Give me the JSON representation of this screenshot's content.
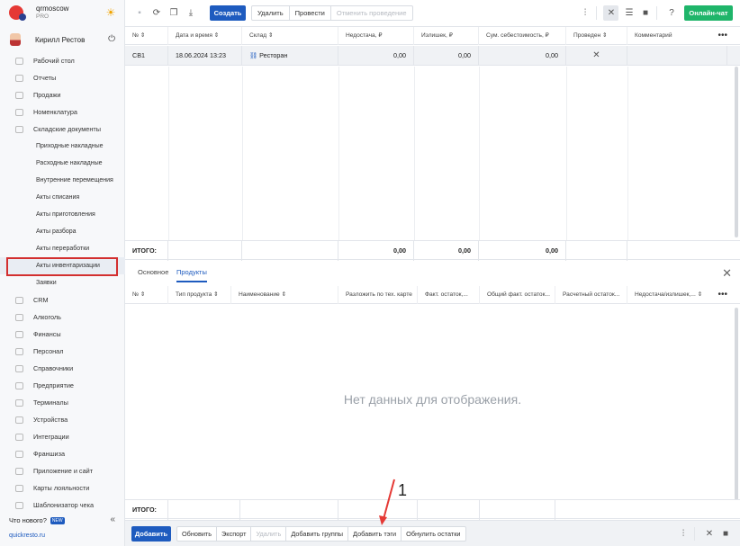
{
  "brand": {
    "name": "qrmoscow",
    "plan": "PRO"
  },
  "user": {
    "name": "Кирилл Рестов"
  },
  "nav": {
    "items": [
      {
        "label": "Рабочий стол"
      },
      {
        "label": "Отчеты"
      },
      {
        "label": "Продажи"
      },
      {
        "label": "Номенклатура"
      },
      {
        "label": "Складские документы"
      }
    ],
    "sub": [
      {
        "label": "Приходные накладные"
      },
      {
        "label": "Расходные накладные"
      },
      {
        "label": "Внутренние перемещения"
      },
      {
        "label": "Акты списания"
      },
      {
        "label": "Акты приготовления"
      },
      {
        "label": "Акты разбора"
      },
      {
        "label": "Акты переработки"
      },
      {
        "label": "Акты инвентаризации"
      },
      {
        "label": "Заявки"
      }
    ],
    "items2": [
      {
        "label": "CRM"
      },
      {
        "label": "Алкоголь"
      },
      {
        "label": "Финансы"
      },
      {
        "label": "Персонал"
      },
      {
        "label": "Справочники"
      },
      {
        "label": "Предприятие"
      },
      {
        "label": "Терминалы"
      },
      {
        "label": "Устройства"
      },
      {
        "label": "Интеграции"
      },
      {
        "label": "Франшиза"
      },
      {
        "label": "Приложение и сайт"
      },
      {
        "label": "Карты лояльности"
      },
      {
        "label": "Шаблонизатор чека"
      }
    ],
    "whatsnew": "Что нового?",
    "new_badge": "NEW",
    "site": "quickresto.ru"
  },
  "toolbar": {
    "create": "Создать",
    "delete": "Удалить",
    "post": "Провести",
    "unpost": "Отменить проведение",
    "chat": "Онлайн-чат"
  },
  "top_table": {
    "headers": [
      "№",
      "Дата и время",
      "Склад",
      "Недостача, ₽",
      "Излишек, ₽",
      "Сум. себестоимость, ₽",
      "Проведен",
      "Комментарий"
    ],
    "sort_mark": "⇕",
    "row": {
      "num": "СВ1",
      "date": "18.06.2024 13:23",
      "warehouse": "Ресторан",
      "shortage": "0,00",
      "surplus": "0,00",
      "cost": "0,00",
      "posted": "✕"
    },
    "totals": {
      "label": "ИТОГО:",
      "shortage": "0,00",
      "surplus": "0,00",
      "cost": "0,00"
    }
  },
  "tabs": [
    {
      "label": "Основное"
    },
    {
      "label": "Продукты"
    }
  ],
  "bottom_table": {
    "headers": [
      "№",
      "Тип продукта",
      "Наименование",
      "Разложить по тех. карте",
      "Факт. остаток,...",
      "Общий факт. остаток...",
      "Расчетный остаток...",
      "Недостача/излишек,..."
    ],
    "empty": "Нет данных для отображения.",
    "totals_label": "ИТОГО:"
  },
  "bottombar": {
    "add": "Добавить",
    "refresh": "Обновить",
    "export": "Экспорт",
    "delete": "Удалить",
    "add_groups": "Добавить группы",
    "add_tags": "Добавить тэги",
    "reset": "Обнулить остатки"
  },
  "annotation": {
    "number": "1"
  },
  "colors": {
    "accent": "#1e5bbf",
    "chat": "#1fb56a",
    "highlight": "#d32f2f"
  }
}
